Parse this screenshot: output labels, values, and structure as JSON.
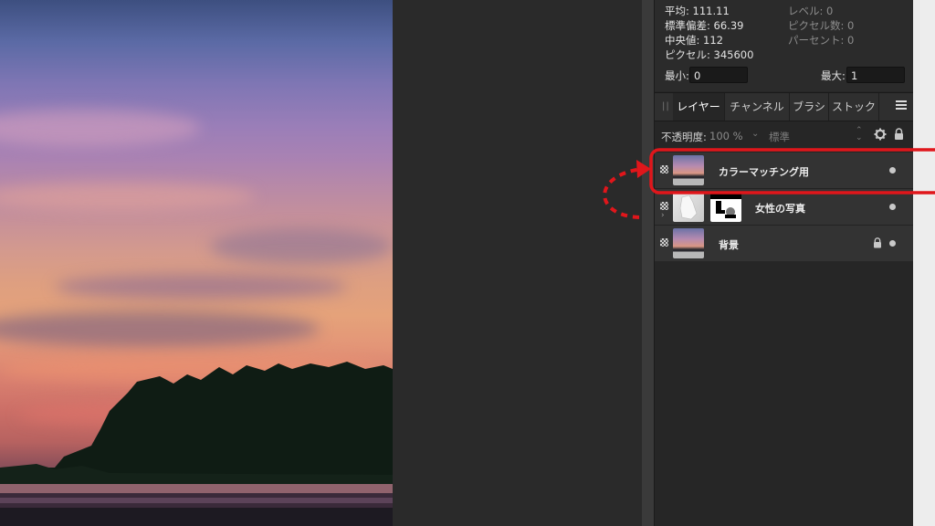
{
  "histogram": {
    "mean": "平均: 111.11",
    "std_dev": "標準偏差: 66.39",
    "median": "中央値: 112",
    "pixels": "ピクセル: 345600",
    "level": "レベル: 0",
    "pixel_count": "ピクセル数: 0",
    "percent": "パーセント: 0",
    "min_label": "最小:",
    "min_value": "0",
    "max_label": "最大:",
    "max_value": "1"
  },
  "tabs": [
    {
      "label": "レイヤー",
      "active": true
    },
    {
      "label": "チャンネル",
      "active": false
    },
    {
      "label": "ブラシ",
      "active": false
    },
    {
      "label": "ストック",
      "active": false
    }
  ],
  "opacity": {
    "label": "不透明度:",
    "value": "100 %",
    "blend_mode": "標準"
  },
  "layers": [
    {
      "name": "カラーマッチング用",
      "visible": true,
      "locked": false,
      "highlighted": true
    },
    {
      "name": "女性の写真",
      "visible": true,
      "locked": false,
      "has_mask": true
    },
    {
      "name": "背景",
      "visible": true,
      "locked": true
    }
  ],
  "colors": {
    "annotation": "#e0161b",
    "panel_bg": "#262626",
    "layer_bg": "#333333"
  },
  "icons": [
    "grip-icon",
    "menu-icon",
    "gear-icon",
    "lock-icon",
    "visibility-dot-icon",
    "checker-icon",
    "expand-arrow-icon"
  ]
}
